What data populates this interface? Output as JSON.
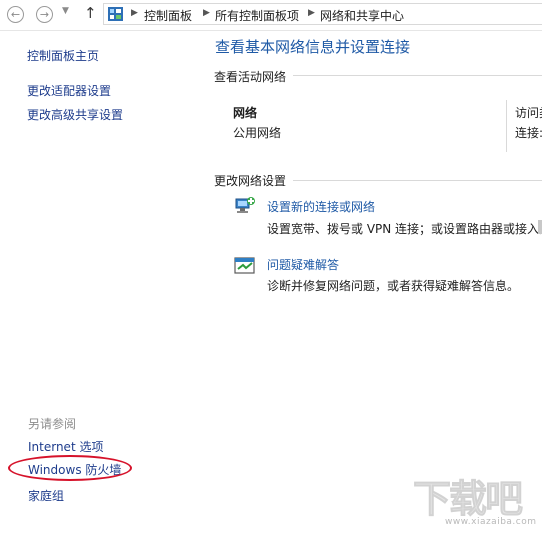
{
  "breadcrumb": {
    "items": [
      "控制面板",
      "所有控制面板项",
      "网络和共享中心"
    ]
  },
  "sidebar": {
    "top_links": [
      "控制面板主页",
      "更改适配器设置",
      "更改高级共享设置"
    ],
    "see_also_label": "另请参阅",
    "see_also_links": [
      "Internet 选项",
      "Windows 防火墙",
      "家庭组"
    ]
  },
  "main": {
    "title": "查看基本网络信息并设置连接",
    "active_networks_heading": "查看活动网络",
    "network": {
      "name": "网络",
      "type": "公用网络",
      "access_type_label": "访问类",
      "connections_label": "连接:"
    },
    "change_settings_heading": "更改网络设置",
    "tasks": [
      {
        "link": "设置新的连接或网络",
        "desc": "设置宽带、拨号或 VPN 连接；或设置路由器或接入点",
        "icon": "network-setup-icon"
      },
      {
        "link": "问题疑难解答",
        "desc": "诊断并修复网络问题，或者获得疑难解答信息。",
        "icon": "troubleshoot-icon"
      }
    ]
  },
  "watermark": {
    "text": "下载吧",
    "url": "www.xiazaiba.com"
  },
  "colors": {
    "link": "#1f5aa6",
    "left_link": "#1e3c8c",
    "highlight_circle": "#d6122a"
  }
}
